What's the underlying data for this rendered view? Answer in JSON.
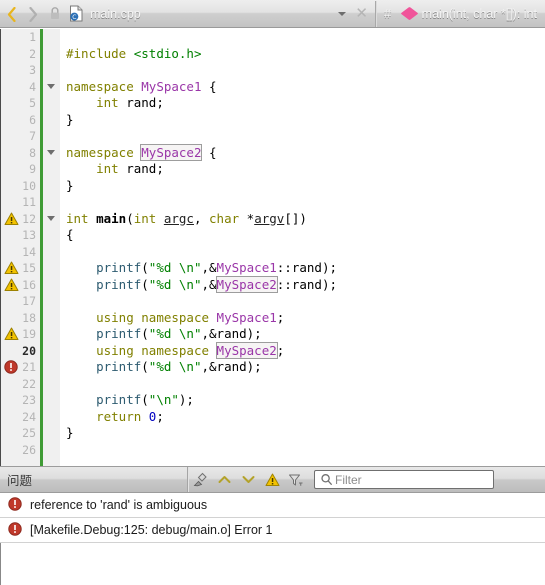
{
  "toolbar": {
    "back_icon": "chevron-left-icon",
    "forward_icon": "chevron-right-icon",
    "lock_icon": "lock-icon",
    "file_icon": "cpp-file-icon",
    "file_name": "main.cpp",
    "dropdown_icon": "chevron-down-icon",
    "close_label": "✕",
    "hash_label": "#",
    "symbol_icon": "function-diamond-icon",
    "symbol_name": "main(int, char *[]): int"
  },
  "editor": {
    "lines": [
      {
        "num": "1",
        "mark": "",
        "fold": false,
        "current": false
      },
      {
        "num": "2",
        "mark": "",
        "fold": false,
        "current": false
      },
      {
        "num": "3",
        "mark": "",
        "fold": false,
        "current": false
      },
      {
        "num": "4",
        "mark": "",
        "fold": true,
        "current": false
      },
      {
        "num": "5",
        "mark": "",
        "fold": false,
        "current": false
      },
      {
        "num": "6",
        "mark": "",
        "fold": false,
        "current": false
      },
      {
        "num": "7",
        "mark": "",
        "fold": false,
        "current": false
      },
      {
        "num": "8",
        "mark": "",
        "fold": true,
        "current": false
      },
      {
        "num": "9",
        "mark": "",
        "fold": false,
        "current": false
      },
      {
        "num": "10",
        "mark": "",
        "fold": false,
        "current": false
      },
      {
        "num": "11",
        "mark": "",
        "fold": false,
        "current": false
      },
      {
        "num": "12",
        "mark": "warning",
        "fold": true,
        "current": false
      },
      {
        "num": "13",
        "mark": "",
        "fold": false,
        "current": false
      },
      {
        "num": "14",
        "mark": "",
        "fold": false,
        "current": false
      },
      {
        "num": "15",
        "mark": "warning",
        "fold": false,
        "current": false
      },
      {
        "num": "16",
        "mark": "warning",
        "fold": false,
        "current": false
      },
      {
        "num": "17",
        "mark": "",
        "fold": false,
        "current": false
      },
      {
        "num": "18",
        "mark": "",
        "fold": false,
        "current": false
      },
      {
        "num": "19",
        "mark": "warning",
        "fold": false,
        "current": false
      },
      {
        "num": "20",
        "mark": "",
        "fold": false,
        "current": true
      },
      {
        "num": "21",
        "mark": "error",
        "fold": false,
        "current": false
      },
      {
        "num": "22",
        "mark": "",
        "fold": false,
        "current": false
      },
      {
        "num": "23",
        "mark": "",
        "fold": false,
        "current": false
      },
      {
        "num": "24",
        "mark": "",
        "fold": false,
        "current": false
      },
      {
        "num": "25",
        "mark": "",
        "fold": false,
        "current": false
      },
      {
        "num": "26",
        "mark": "",
        "fold": false,
        "current": false
      }
    ],
    "source_lines": [
      "",
      "#include <stdio.h>",
      "",
      "namespace MySpace1 {",
      "    int rand;",
      "}",
      "",
      "namespace MySpace2 {",
      "    int rand;",
      "}",
      "",
      "int main(int argc, char *argv[])",
      "{",
      "",
      "    printf(\"%d \\n\",&MySpace1::rand);",
      "    printf(\"%d \\n\",&MySpace2::rand);",
      "",
      "    using namespace MySpace1;",
      "    printf(\"%d \\n\",&rand);",
      "    using namespace MySpace2;",
      "    printf(\"%d \\n\",&rand);",
      "",
      "    printf(\"\\n\");",
      "    return 0;",
      "}",
      ""
    ]
  },
  "panel": {
    "title": "问题",
    "clear_icon": "clear-broom-icon",
    "prev_icon": "chevron-up-icon",
    "next_icon": "chevron-down-icon",
    "warning_icon": "warning-triangle-icon",
    "filter_icon": "filter-funnel-icon",
    "search_icon": "search-icon",
    "filter_placeholder": "Filter",
    "filter_value": "",
    "issues": [
      {
        "severity": "error",
        "text": "reference to 'rand' is ambiguous"
      },
      {
        "severity": "error",
        "text": "[Makefile.Debug:125: debug/main.o] Error 1"
      }
    ]
  },
  "colors": {
    "green_modified_bar": "#3f9b35",
    "keyword": "#808000",
    "string": "#008000",
    "namespace": "#9a36a8",
    "function": "#2d5b70",
    "number": "#0000c0",
    "error_red": "#c0392b",
    "warning_yellow": "#f2c200",
    "symbol_pink": "#f0549a"
  }
}
